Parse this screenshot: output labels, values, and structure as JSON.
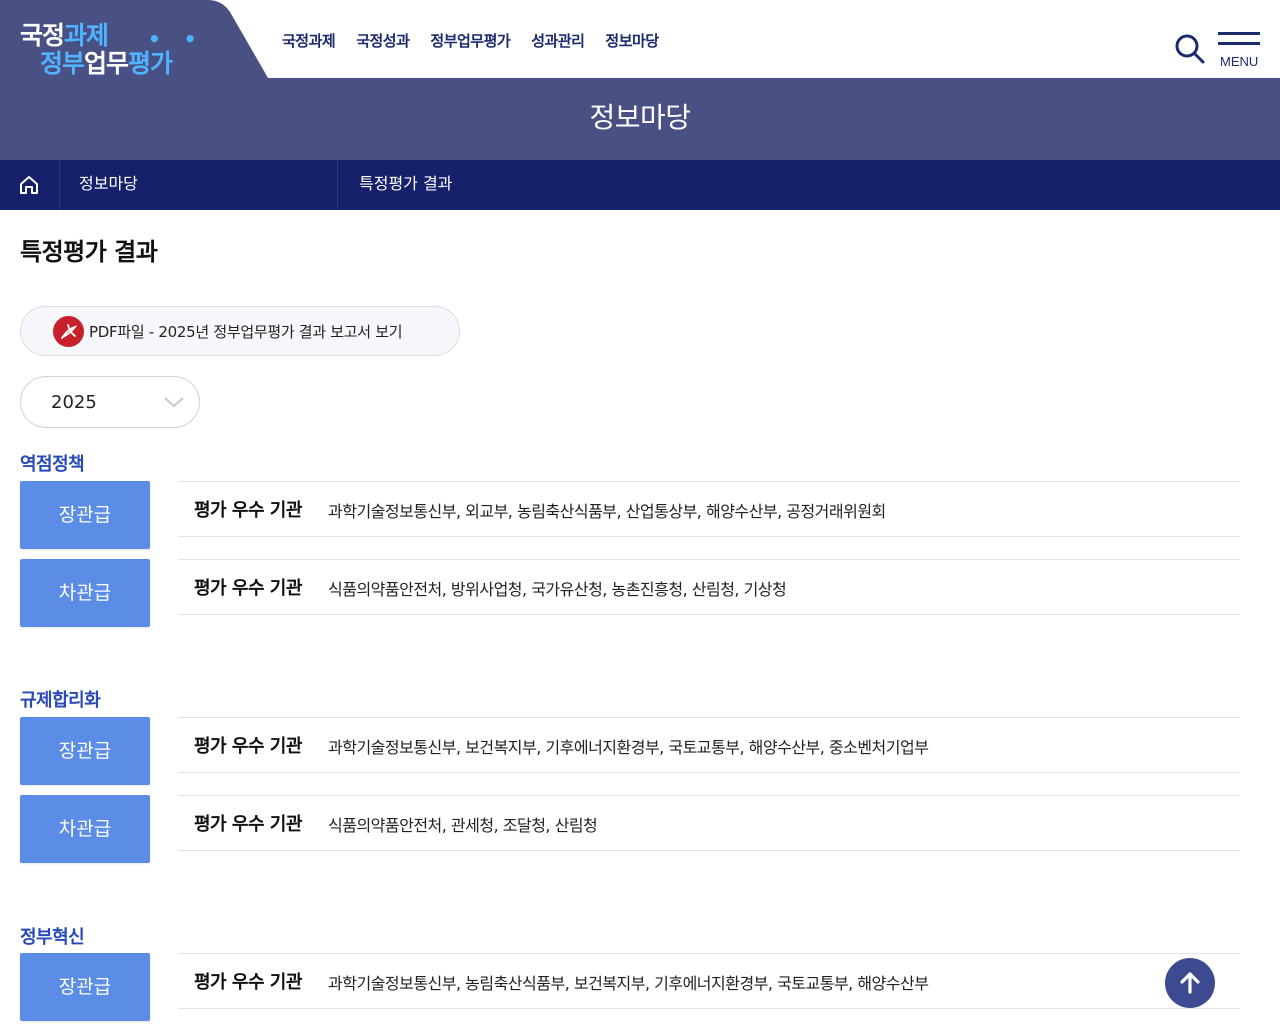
{
  "logo": {
    "line1_a": "국정",
    "line1_b": "과제",
    "line2_a": "정부",
    "line2_b": "업무",
    "line2_c": "평가",
    "dots": "• •"
  },
  "gnb": [
    "국정과제",
    "국정성과",
    "정부업무평가",
    "성과관리",
    "정보마당"
  ],
  "menu_label": "MENU",
  "page_band_title": "정보마당",
  "breadcrumb": {
    "level1": "정보마당",
    "level2": "특정평가 결과"
  },
  "page_title": "특정평가 결과",
  "pdf_link": "PDF파일 - 2025년 정부업무평가 결과 보고서 보기",
  "year_select": {
    "value": "2025"
  },
  "label_excellent": "평가 우수 기관",
  "sections": [
    {
      "title": "역점정책",
      "grades": [
        {
          "grade": "장관급",
          "orgs": "과학기술정보통신부, 외교부, 농림축산식품부, 산업통상부, 해양수산부, 공정거래위원회"
        },
        {
          "grade": "차관급",
          "orgs": "식품의약품안전처, 방위사업청, 국가유산청, 농촌진흥청, 산림청, 기상청"
        }
      ]
    },
    {
      "title": "규제합리화",
      "grades": [
        {
          "grade": "장관급",
          "orgs": "과학기술정보통신부, 보건복지부, 기후에너지환경부, 국토교통부, 해양수산부, 중소벤처기업부"
        },
        {
          "grade": "차관급",
          "orgs": "식품의약품안전처, 관세청, 조달청, 산림청"
        }
      ]
    },
    {
      "title": "정부혁신",
      "grades": [
        {
          "grade": "장관급",
          "orgs": "과학기술정보통신부, 농림축산식품부, 보건복지부, 기후에너지환경부, 국토교통부, 해양수산부"
        }
      ]
    }
  ],
  "colors": {
    "header_band": "#495184",
    "breadcrumb_bg": "#17206a",
    "grade_button": "#5b8de6",
    "section_title": "#2849b8",
    "top_button": "#3d4a8f",
    "pdf_icon": "#c8202a"
  },
  "icons": [
    "home-icon",
    "search-icon",
    "hamburger-icon",
    "pdf-icon",
    "chevron-down-icon",
    "arrow-up-icon"
  ]
}
